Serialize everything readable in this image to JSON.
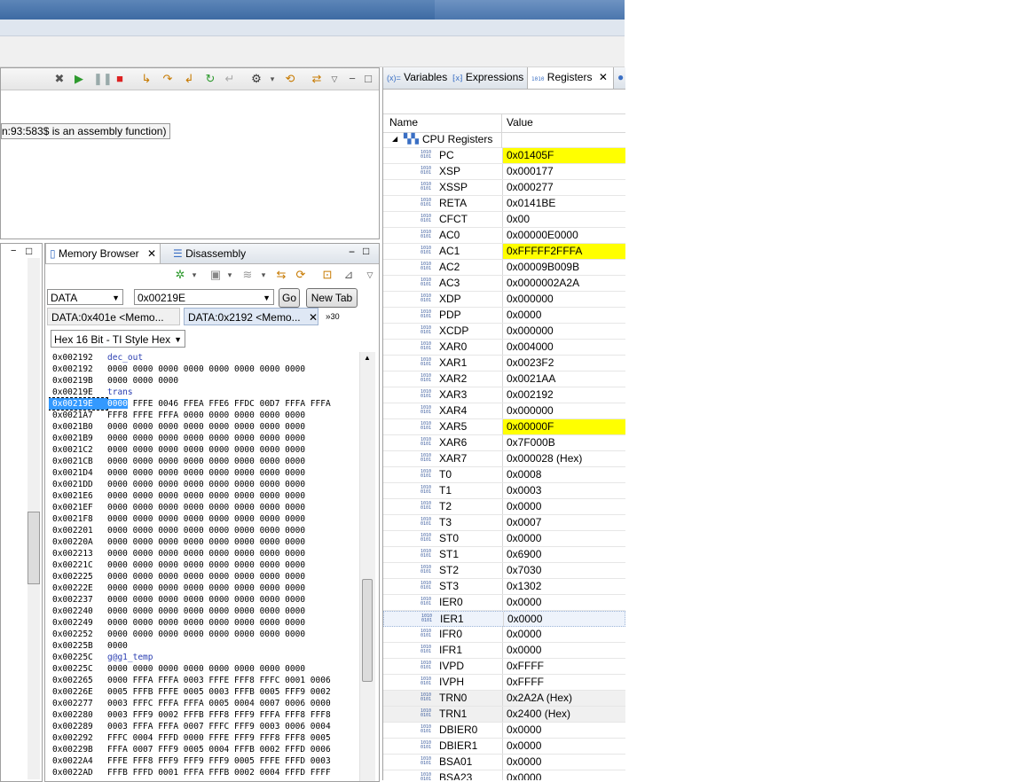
{
  "debug": {
    "message": "n:93:583$ is an assembly function)"
  },
  "memory_browser": {
    "tab_label": "Memory Browser",
    "disassembly_label": "Disassembly",
    "page_select": "DATA",
    "address_input": "0x00219E",
    "go_label": "Go",
    "new_tab_label": "New Tab",
    "subtabs": [
      "DATA:0x401e <Memo...",
      "DATA:0x2192 <Memo..."
    ],
    "overflow_count": "30",
    "format_select": "Hex 16 Bit - TI Style Hex",
    "rows": [
      {
        "addr": "0x002192",
        "label": "dec_out"
      },
      {
        "addr": "0x002192",
        "data": "0000 0000 0000 0000 0000 0000 0000 0000"
      },
      {
        "addr": "0x00219B",
        "data": "0000 0000 0000"
      },
      {
        "addr": "0x00219E",
        "label": "trans"
      },
      {
        "addr": "0x00219E",
        "first": "0000",
        "data": " FFFE 0046 FFEA FFE6 FFDC 00D7 FFFA FFFA",
        "selected": true
      },
      {
        "addr": "0x0021A7",
        "data": "FFF8 FFFE FFFA 0000 0000 0000 0000 0000"
      },
      {
        "addr": "0x0021B0",
        "data": "0000 0000 0000 0000 0000 0000 0000 0000"
      },
      {
        "addr": "0x0021B9",
        "data": "0000 0000 0000 0000 0000 0000 0000 0000"
      },
      {
        "addr": "0x0021C2",
        "data": "0000 0000 0000 0000 0000 0000 0000 0000"
      },
      {
        "addr": "0x0021CB",
        "data": "0000 0000 0000 0000 0000 0000 0000 0000"
      },
      {
        "addr": "0x0021D4",
        "data": "0000 0000 0000 0000 0000 0000 0000 0000"
      },
      {
        "addr": "0x0021DD",
        "data": "0000 0000 0000 0000 0000 0000 0000 0000"
      },
      {
        "addr": "0x0021E6",
        "data": "0000 0000 0000 0000 0000 0000 0000 0000"
      },
      {
        "addr": "0x0021EF",
        "data": "0000 0000 0000 0000 0000 0000 0000 0000"
      },
      {
        "addr": "0x0021F8",
        "data": "0000 0000 0000 0000 0000 0000 0000 0000"
      },
      {
        "addr": "0x002201",
        "data": "0000 0000 0000 0000 0000 0000 0000 0000"
      },
      {
        "addr": "0x00220A",
        "data": "0000 0000 0000 0000 0000 0000 0000 0000"
      },
      {
        "addr": "0x002213",
        "data": "0000 0000 0000 0000 0000 0000 0000 0000"
      },
      {
        "addr": "0x00221C",
        "data": "0000 0000 0000 0000 0000 0000 0000 0000"
      },
      {
        "addr": "0x002225",
        "data": "0000 0000 0000 0000 0000 0000 0000 0000"
      },
      {
        "addr": "0x00222E",
        "data": "0000 0000 0000 0000 0000 0000 0000 0000"
      },
      {
        "addr": "0x002237",
        "data": "0000 0000 0000 0000 0000 0000 0000 0000"
      },
      {
        "addr": "0x002240",
        "data": "0000 0000 0000 0000 0000 0000 0000 0000"
      },
      {
        "addr": "0x002249",
        "data": "0000 0000 0000 0000 0000 0000 0000 0000"
      },
      {
        "addr": "0x002252",
        "data": "0000 0000 0000 0000 0000 0000 0000 0000"
      },
      {
        "addr": "0x00225B",
        "data": "0000"
      },
      {
        "addr": "0x00225C",
        "label": "g@g1_temp"
      },
      {
        "addr": "0x00225C",
        "data": "0000 0000 0000 0000 0000 0000 0000 0000"
      },
      {
        "addr": "0x002265",
        "data": "0000 FFFA FFFA 0003 FFFE FFF8 FFFC 0001 0006"
      },
      {
        "addr": "0x00226E",
        "data": "0005 FFFB FFFE 0005 0003 FFFB 0005 FFF9 0002"
      },
      {
        "addr": "0x002277",
        "data": "0003 FFFC FFFA FFFA 0005 0004 0007 0006 0000"
      },
      {
        "addr": "0x002280",
        "data": "0003 FFF9 0002 FFFB FFF8 FFF9 FFFA FFF8 FFF8"
      },
      {
        "addr": "0x002289",
        "data": "0003 FFFA FFFA 0007 FFFC FFF9 0003 0006 0004"
      },
      {
        "addr": "0x002292",
        "data": "FFFC 0004 FFFD 0000 FFFE FFF9 FFF8 FFF8 0005"
      },
      {
        "addr": "0x00229B",
        "data": "FFFA 0007 FFF9 0005 0004 FFFB 0002 FFFD 0006"
      },
      {
        "addr": "0x0022A4",
        "data": "FFFE FFF8 FFF9 FFF9 FFF9 0005 FFFE FFFD 0003"
      },
      {
        "addr": "0x0022AD",
        "data": "FFFB FFFD 0001 FFFA FFFB 0002 0004 FFFD FFFF"
      }
    ]
  },
  "registers_view": {
    "tabs": [
      {
        "icon": "(x)=",
        "label": "Variables"
      },
      {
        "icon": "⁅x⁆",
        "label": "Expressions"
      },
      {
        "icon": "1010",
        "label": "Registers"
      }
    ],
    "col_name": "Name",
    "col_value": "Value",
    "group_label": "CPU Registers",
    "colors": {
      "highlight": "#ffff00"
    },
    "registers": [
      {
        "name": "PC",
        "value": "0x01405F",
        "changed": true
      },
      {
        "name": "XSP",
        "value": "0x000177"
      },
      {
        "name": "XSSP",
        "value": "0x000277"
      },
      {
        "name": "RETA",
        "value": "0x0141BE"
      },
      {
        "name": "CFCT",
        "value": "0x00"
      },
      {
        "name": "AC0",
        "value": "0x00000E0000"
      },
      {
        "name": "AC1",
        "value": "0xFFFFF2FFFA",
        "changed": true
      },
      {
        "name": "AC2",
        "value": "0x00009B009B"
      },
      {
        "name": "AC3",
        "value": "0x0000002A2A"
      },
      {
        "name": "XDP",
        "value": "0x000000"
      },
      {
        "name": "PDP",
        "value": "0x0000"
      },
      {
        "name": "XCDP",
        "value": "0x000000"
      },
      {
        "name": "XAR0",
        "value": "0x004000"
      },
      {
        "name": "XAR1",
        "value": "0x0023F2"
      },
      {
        "name": "XAR2",
        "value": "0x0021AA"
      },
      {
        "name": "XAR3",
        "value": "0x002192"
      },
      {
        "name": "XAR4",
        "value": "0x000000"
      },
      {
        "name": "XAR5",
        "value": "0x00000F",
        "changed": true
      },
      {
        "name": "XAR6",
        "value": "0x7F000B"
      },
      {
        "name": "XAR7",
        "value": "0x000028 (Hex)"
      },
      {
        "name": "T0",
        "value": "0x0008"
      },
      {
        "name": "T1",
        "value": "0x0003"
      },
      {
        "name": "T2",
        "value": "0x0000"
      },
      {
        "name": "T3",
        "value": "0x0007"
      },
      {
        "name": "ST0",
        "value": "0x0000"
      },
      {
        "name": "ST1",
        "value": "0x6900"
      },
      {
        "name": "ST2",
        "value": "0x7030"
      },
      {
        "name": "ST3",
        "value": "0x1302"
      },
      {
        "name": "IER0",
        "value": "0x0000"
      },
      {
        "name": "IER1",
        "value": "0x0000",
        "hover": true
      },
      {
        "name": "IFR0",
        "value": "0x0000"
      },
      {
        "name": "IFR1",
        "value": "0x0000"
      },
      {
        "name": "IVPD",
        "value": "0xFFFF"
      },
      {
        "name": "IVPH",
        "value": "0xFFFF"
      },
      {
        "name": "TRN0",
        "value": "0x2A2A (Hex)",
        "selected": true
      },
      {
        "name": "TRN1",
        "value": "0x2400 (Hex)",
        "selected": true
      },
      {
        "name": "DBIER0",
        "value": "0x0000"
      },
      {
        "name": "DBIER1",
        "value": "0x0000"
      },
      {
        "name": "BSA01",
        "value": "0x0000"
      },
      {
        "name": "BSA23",
        "value": "0x0000"
      }
    ]
  }
}
